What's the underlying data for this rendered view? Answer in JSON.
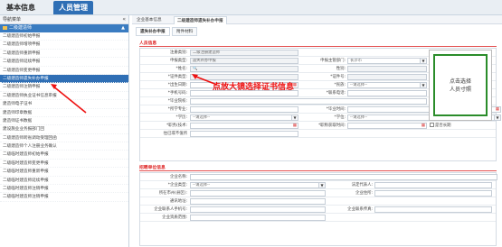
{
  "app": {
    "tab_basic": "基本信息",
    "tab_personnel": "人员管理"
  },
  "sidebar": {
    "title": "导航菜单",
    "collapse": "«",
    "group": "二级建造师",
    "items": [
      "二级建造师初始申报",
      "二级建造师增项申报",
      "二级建造师重新申报",
      "二级建造师延续申报",
      "二级建造师变更申报",
      "二级建造师遗失补办申报",
      "二级建造师注销申报",
      "二级建造师执业证书信息审报",
      "建造师电子证书",
      "建造师印章数据",
      "建造师证书数据",
      "建设施业业务报部门回",
      "二级建造师跨省调动受理回函",
      "二级建造师个人注册业务确认",
      "二级临时建造师初始申报",
      "二级临时建造师变更申报",
      "二级临时建造师重新申报",
      "二级临时建造师延续申报",
      "二级临时建造师注销申报",
      "二级临时建造师注销申报"
    ],
    "active_index": 5
  },
  "breadcrumbs": [
    "企业基本信息",
    "二级建造师遗失补办申报"
  ],
  "subtabs": [
    "遗失补办申报",
    "附件材料"
  ],
  "section1": {
    "title": "人员信息"
  },
  "form": {
    "reg_type_label": "注册类别:",
    "reg_type_value": "二级注册建造师",
    "apply_type_label": "申报类型:",
    "apply_type_value": "遗失补办申报",
    "dept_label": "申报主管部门:",
    "dept_value": "长沙市",
    "name_label": "*姓名:",
    "name_value": "",
    "gender_label": "性别:",
    "idtype_label": "*证件类型:",
    "idno_label": "*证件号:",
    "birth_label": "*出生日期:",
    "nation_label": "*民族:",
    "nation_value": "--请选择--",
    "phone_label": "*手机号码:",
    "tel_label": "*联系电话:",
    "school_label": "*毕业院校:",
    "major_label": "*所学专业:",
    "gradtime_label": "*毕业时间:",
    "degree_label": "*学历:",
    "degree_value": "--请选择--",
    "degree2_label": "*学位:",
    "degree2_value": "--请选择--",
    "jobstart_label": "*职务(技术:",
    "jobend_label": "*职称获取时间:",
    "longterm_label": "是否长期",
    "agency_label": "住已或不值所",
    "photo_line1": "点击选择",
    "photo_line2": "人员寸照"
  },
  "section2": {
    "title": "招聘单位信息",
    "company_label": "企业名称:",
    "ctype_label": "*企业类型:",
    "ctype_value": "--请选择--",
    "legal_label": "法定代表人:",
    "addr_label": "所在市州(县区):",
    "zip_label": "企业住所:",
    "mail_label": "通讯地址:",
    "contact_label": "企业联系人手机号:",
    "fax_label": "企业联系传真:",
    "qual_label": "企业资质范围:"
  },
  "annotation": "点放大镜选择证书信息",
  "colors": {
    "accent": "#2f6fb5",
    "required": "#d22",
    "highlight": "#2a8c2a"
  }
}
